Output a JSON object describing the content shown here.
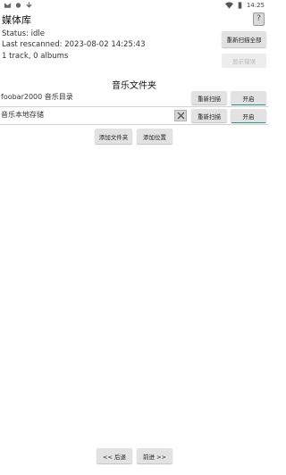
{
  "statusbar": {
    "time": "14:25"
  },
  "header": {
    "title": "媒体库",
    "help_label": "?"
  },
  "info": {
    "status": "Status: idle",
    "last_rescanned": "Last rescanned: 2023-08-02 14:25:43",
    "counts": "1 track, 0 albums"
  },
  "actions": {
    "rescan_all": "重新扫描全部",
    "show_errors": "显示错误"
  },
  "folders": {
    "title": "音乐文件夹",
    "items": [
      {
        "name": "foobar2000 音乐目录",
        "rescan": "重新扫描",
        "toggle": "开启"
      },
      {
        "name": "音乐本地存储",
        "rescan": "重新扫描",
        "toggle": "开启"
      }
    ],
    "add_folder": "添加文件夹",
    "add_location": "添加位置"
  },
  "nav": {
    "back": "<< 后退",
    "forward": "前进 >>"
  },
  "colors": {
    "accent": "#2d8f85",
    "button_bg": "#e2e2e2"
  }
}
